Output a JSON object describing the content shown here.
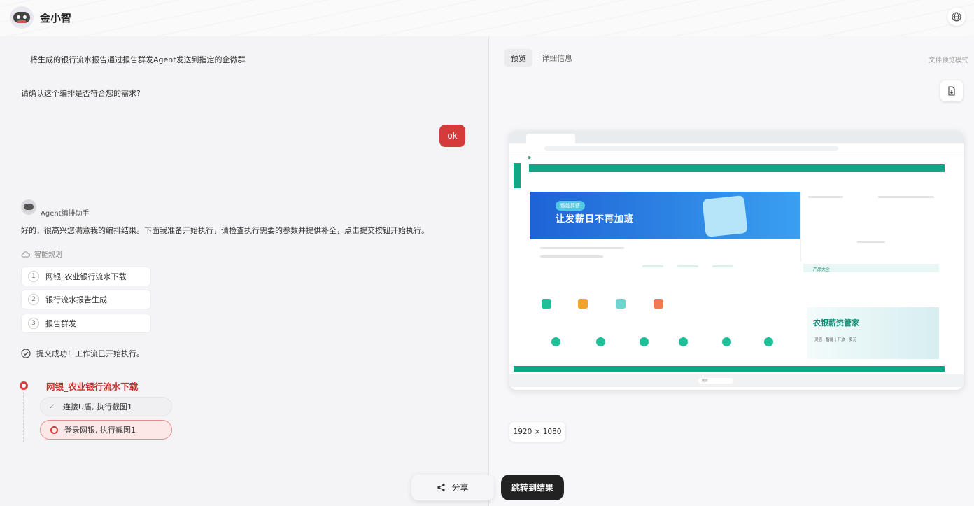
{
  "header": {
    "app_name": "金小智"
  },
  "chat": {
    "user_request": "将生成的银行流水报告通过报告群发Agent发送到指定的企微群",
    "confirm_question": "请确认这个编排是否符合您的需求?",
    "user_reply": "ok",
    "assistant_name": "Agent编排助手",
    "assistant_message": "好的，很高兴您满意我的编排结果。下面我准备开始执行，请检查执行需要的参数并提供补全，点击提交按钮开始执行。",
    "plan_title": "智能规划",
    "plan_steps": [
      {
        "num": "1",
        "label": "网银_农业银行流水下载"
      },
      {
        "num": "2",
        "label": "银行流水报告生成"
      },
      {
        "num": "3",
        "label": "报告群发"
      }
    ],
    "submit_status": "提交成功！工作流已开始执行。",
    "running_task": {
      "title": "网银_农业银行流水下载",
      "substeps": [
        {
          "label": "连接U盾, 执行截图1",
          "state": "done"
        },
        {
          "label": "登录网银, 执行截图1",
          "state": "active"
        }
      ]
    }
  },
  "preview": {
    "tabs": [
      "预览",
      "详细信息"
    ],
    "mode_label": "文件预览模式",
    "resolution": "1920 × 1080",
    "screenshot": {
      "banner_tag": "智能算薪",
      "banner_text": "让发薪日不再加班",
      "ad_title": "农银薪资管家",
      "ad_sub": "灵活 | 智能 | 开放 | 多元",
      "product_title": "产品大全",
      "taskbar_search": "搜索"
    }
  },
  "actions": {
    "share_label": "分享",
    "jump_label": "跳转到结果"
  }
}
